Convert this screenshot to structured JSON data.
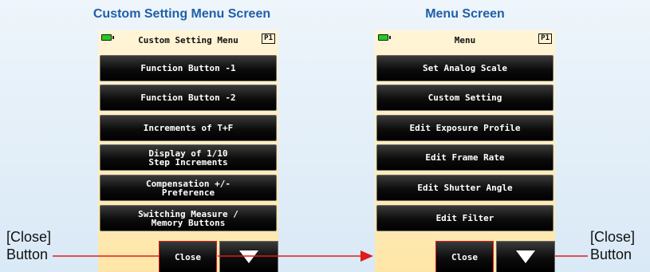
{
  "left_screen": {
    "heading": "Custom Setting Menu Screen",
    "title": "Custom Setting Menu",
    "page_indicator": "P1",
    "items": [
      {
        "label": "Function Button -1"
      },
      {
        "label": "Function Button -2"
      },
      {
        "label": "Increments of T+F"
      },
      {
        "label": "Display of 1/10\nStep Increments"
      },
      {
        "label": "Compensation +/-\nPreference"
      },
      {
        "label": "Switching Measure /\nMemory Buttons"
      }
    ],
    "close_label": "Close"
  },
  "right_screen": {
    "heading": "Menu Screen",
    "title": "Menu",
    "page_indicator": "P1",
    "items": [
      {
        "label": "Set Analog Scale"
      },
      {
        "label": "Custom Setting"
      },
      {
        "label": "Edit Exposure Profile"
      },
      {
        "label": "Edit Frame Rate"
      },
      {
        "label": "Edit Shutter Angle"
      },
      {
        "label": "Edit Filter"
      }
    ],
    "close_label": "Close"
  },
  "callouts": {
    "left_line1": "[Close]",
    "left_line2": "Button",
    "right_line1": "[Close]",
    "right_line2": "Button"
  },
  "icons": {
    "battery": "battery-icon",
    "scroll_down": "triangle-down-icon",
    "arrow": "arrow-right-icon"
  },
  "colors": {
    "heading": "#1f5fa6",
    "screen_bg": "#ffeebf",
    "button_bg": "#000000",
    "highlight": "#e01b1b",
    "battery": "#22cc22"
  }
}
